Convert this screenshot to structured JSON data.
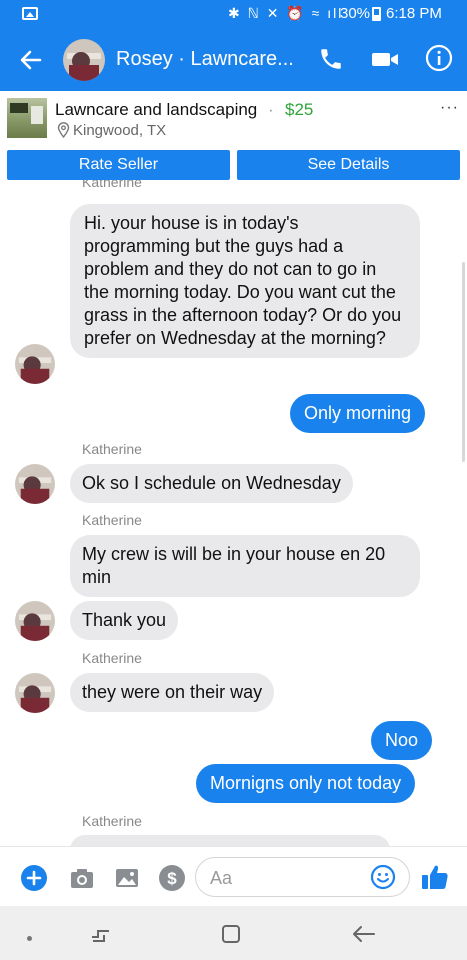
{
  "status_bar": {
    "sys_icons": "✱ ℕ ✕ ⏰ ≈ ıll",
    "battery": "30%",
    "time": "6:18 PM"
  },
  "header": {
    "title": "Rosey · Lawncare..."
  },
  "listing": {
    "title": "Lawncare and landscaping",
    "separator": "·",
    "price": "$25",
    "location": "Kingwood, TX",
    "more": "···"
  },
  "buttons": {
    "rate_seller": "Rate Seller",
    "see_details": "See Details"
  },
  "chat": {
    "cut_sender": "Katherine",
    "messages": [
      {
        "text": "Hi. your house is in today's programming but the guys had a problem and they do not can to go in the morning today. Do you want cut the grass  in the afternoon today? Or do you prefer on Wednesday at the morning?"
      },
      {
        "text": "Only morning"
      },
      {
        "sender": "Katherine",
        "text": "Ok so I schedule on Wednesday"
      },
      {
        "sender": "Katherine",
        "text": "My crew is will be in your house en 20 min"
      },
      {
        "text": "Thank you"
      },
      {
        "sender": "Katherine",
        "text": "they were on their way"
      },
      {
        "text": "Noo"
      },
      {
        "text": "Mornigns only not today"
      },
      {
        "sender": "Katherine"
      }
    ]
  },
  "composer": {
    "placeholder": "Aa"
  },
  "colors": {
    "accent": "#1a82ec",
    "bubble_incoming": "#e9e9eb",
    "price": "#2fa53a"
  }
}
